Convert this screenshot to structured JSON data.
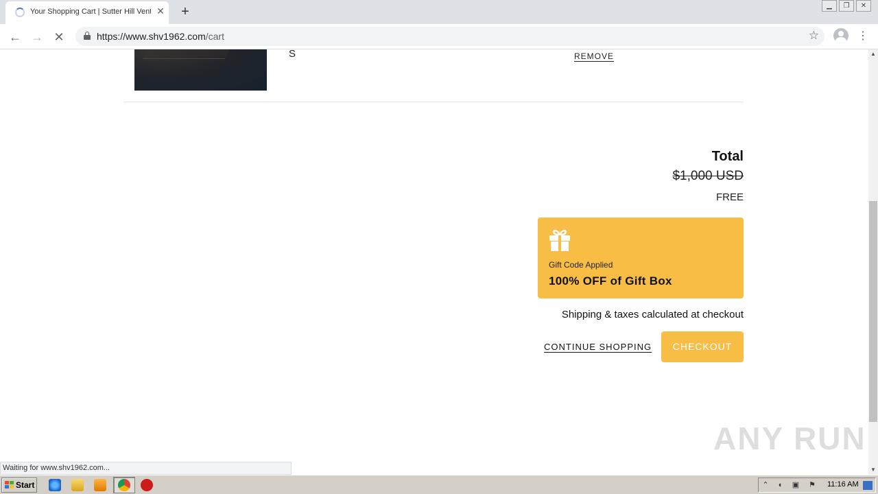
{
  "browser": {
    "tab_title": "Your Shopping Cart | Sutter Hill Ventures",
    "url_host": "https://www.shv1962.com",
    "url_path": "/cart",
    "status_text": "Waiting for www.shv1962.com..."
  },
  "cart": {
    "item_size": "S",
    "remove_label": "REMOVE",
    "total_label": "Total",
    "original_total": "$1,000 USD",
    "final_total": "FREE",
    "gift": {
      "label": "Gift Code Applied",
      "title": "100% OFF of Gift Box"
    },
    "shipping_note": "Shipping & taxes calculated at checkout",
    "continue_label": "CONTINUE SHOPPING",
    "checkout_label": "CHECKOUT"
  },
  "watermark": "ANY RUN",
  "taskbar": {
    "start_label": "Start",
    "clock": "11:16 AM"
  },
  "colors": {
    "accent": "#f8bd45"
  }
}
